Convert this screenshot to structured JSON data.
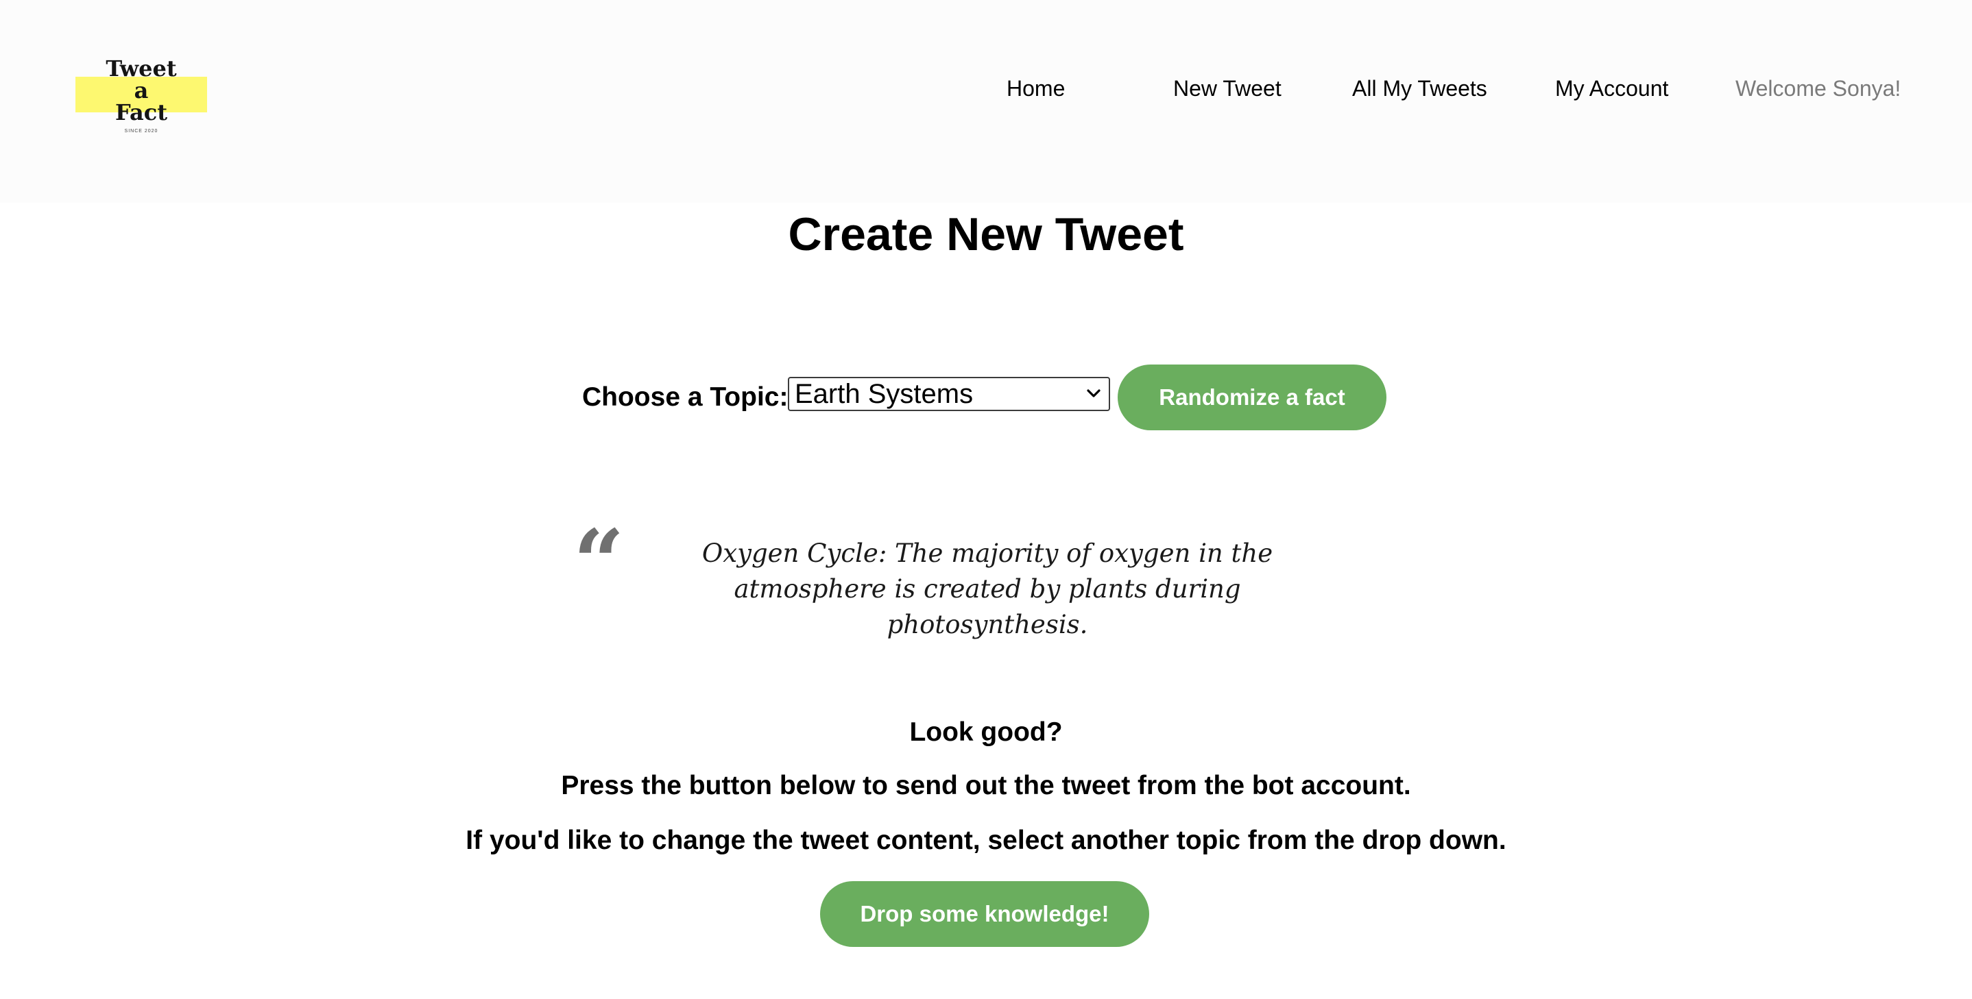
{
  "logo": {
    "lines": [
      "Tweet",
      "a",
      "Fact"
    ],
    "since": "SINCE 2020",
    "highlight_color": "#fdf870"
  },
  "nav": {
    "home": "Home",
    "new_tweet": "New Tweet",
    "all_tweets": "All My Tweets",
    "my_account": "My Account",
    "welcome": "Welcome Sonya!"
  },
  "main": {
    "title": "Create New Tweet",
    "topic_label": "Choose a Topic:",
    "topic_selected": "Earth Systems",
    "randomize_button": "Randomize a fact",
    "quote_icon": "quote-mark-icon",
    "fact_text": "Oxygen Cycle: The majority of oxygen in the atmosphere is created by plants during photosynthesis.",
    "look_good": "Look good?",
    "instruction_1": "Press the button below to send out the tweet from the bot account.",
    "instruction_2": "If you'd like to change the tweet content, select another topic from the drop down.",
    "submit_button": "Drop some knowledge!"
  },
  "colors": {
    "accent_green": "#6aae5e",
    "navbar_bg": "#fcfcfc",
    "welcome_text": "#7a7a7a"
  }
}
